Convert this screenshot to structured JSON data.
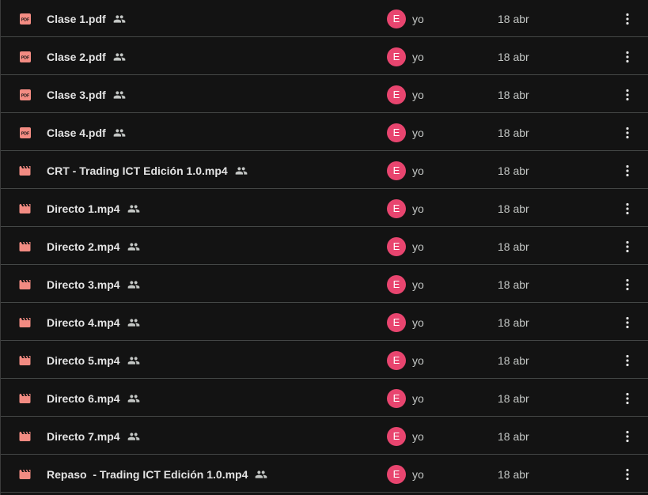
{
  "colors": {
    "background": "#131313",
    "row_divider": "#444746",
    "pdf_icon": "#f28b82",
    "video_icon": "#f28b82",
    "avatar": "#e8456f",
    "text_primary": "#e3e3e3",
    "text_secondary": "#c4c7c5"
  },
  "files": [
    {
      "name": "Clase 1.pdf",
      "type": "pdf",
      "icon": "pdf-icon",
      "shared": true,
      "owner_initial": "E",
      "owner": "yo",
      "modified": "18 abr"
    },
    {
      "name": "Clase 2.pdf",
      "type": "pdf",
      "icon": "pdf-icon",
      "shared": true,
      "owner_initial": "E",
      "owner": "yo",
      "modified": "18 abr"
    },
    {
      "name": "Clase 3.pdf",
      "type": "pdf",
      "icon": "pdf-icon",
      "shared": true,
      "owner_initial": "E",
      "owner": "yo",
      "modified": "18 abr"
    },
    {
      "name": "Clase 4.pdf",
      "type": "pdf",
      "icon": "pdf-icon",
      "shared": true,
      "owner_initial": "E",
      "owner": "yo",
      "modified": "18 abr"
    },
    {
      "name": "CRT - Trading ICT Edición 1.0.mp4",
      "type": "video",
      "icon": "video-icon",
      "shared": true,
      "owner_initial": "E",
      "owner": "yo",
      "modified": "18 abr"
    },
    {
      "name": "Directo 1.mp4",
      "type": "video",
      "icon": "video-icon",
      "shared": true,
      "owner_initial": "E",
      "owner": "yo",
      "modified": "18 abr"
    },
    {
      "name": "Directo 2.mp4",
      "type": "video",
      "icon": "video-icon",
      "shared": true,
      "owner_initial": "E",
      "owner": "yo",
      "modified": "18 abr"
    },
    {
      "name": "Directo 3.mp4",
      "type": "video",
      "icon": "video-icon",
      "shared": true,
      "owner_initial": "E",
      "owner": "yo",
      "modified": "18 abr"
    },
    {
      "name": "Directo 4.mp4",
      "type": "video",
      "icon": "video-icon",
      "shared": true,
      "owner_initial": "E",
      "owner": "yo",
      "modified": "18 abr"
    },
    {
      "name": "Directo 5.mp4",
      "type": "video",
      "icon": "video-icon",
      "shared": true,
      "owner_initial": "E",
      "owner": "yo",
      "modified": "18 abr"
    },
    {
      "name": "Directo 6.mp4",
      "type": "video",
      "icon": "video-icon",
      "shared": true,
      "owner_initial": "E",
      "owner": "yo",
      "modified": "18 abr"
    },
    {
      "name": "Directo 7.mp4",
      "type": "video",
      "icon": "video-icon",
      "shared": true,
      "owner_initial": "E",
      "owner": "yo",
      "modified": "18 abr"
    },
    {
      "name": "Repaso  - Trading ICT Edición 1.0.mp4",
      "type": "video",
      "icon": "video-icon",
      "shared": true,
      "owner_initial": "E",
      "owner": "yo",
      "modified": "18 abr"
    }
  ]
}
